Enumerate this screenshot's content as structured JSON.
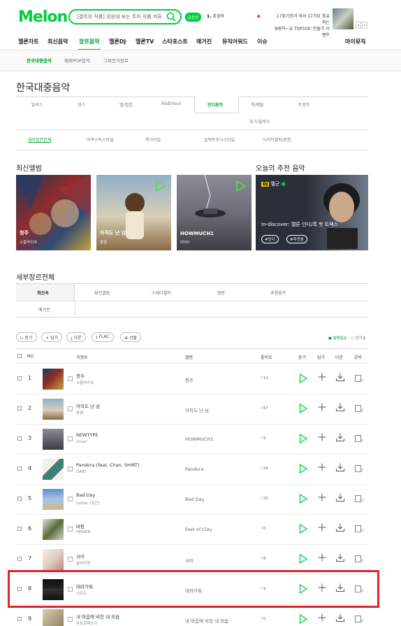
{
  "header": {
    "logo": "Melon",
    "search_text": "[결주의 작품] 망원에 보는 주차 작품 피류",
    "keyword_badge": "급상승",
    "keyword_rank": "1.",
    "keyword_text": "흑섬바",
    "banner_text_1": "17위기진과 와서 17가요 혹유외는",
    "banner_text_2": "'8원하~유 TOP100' 만들기 이벤트",
    "banner_prev": "‹",
    "banner_next": "›"
  },
  "main_nav": {
    "items": [
      "멜론차트",
      "최신음악",
      "장르음악",
      "멜론DJ",
      "멜론TV",
      "스타포스트",
      "매거진",
      "뮤직어워드",
      "이슈"
    ],
    "right": "마이뮤직"
  },
  "sub_nav": {
    "items": [
      "한국대중음악",
      "해외POP음악",
      "그외인기장르"
    ]
  },
  "page_title": "한국대중음악",
  "genres": {
    "row1": [
      "발라드",
      "댄스",
      "랩/힙합",
      "R&B/Soul",
      "인디음악",
      "록/메탈",
      "트로트"
    ],
    "row2": [
      "포크/블루스"
    ],
    "detail": [
      "세부장르전체",
      "어쿠스틱스타일",
      "록스타일",
      "일렉트로닉스타일",
      "사이키델릭/원천"
    ]
  },
  "latest_albums": {
    "title": "최신앨범",
    "items": [
      {
        "name": "청주",
        "artist": "소울라이츠"
      },
      {
        "name": "아직도 난 넘",
        "artist": "윤형"
      },
      {
        "name": "HOWMUCH1",
        "artist": "DYDI"
      }
    ]
  },
  "recommend": {
    "title": "오늘의 추천 음악",
    "dj_badge": "DJ",
    "dj_name": "멜군",
    "text": "In-discover: 멜론 인디/록 핫 트랙스",
    "tags": [
      "#인디",
      "#추천음"
    ]
  },
  "subgenre": {
    "title": "세부장르전체",
    "tabs": [
      "최신곡",
      "최신앨범",
      "스테디셀러",
      "명반",
      "추천음악",
      "매거진"
    ]
  },
  "actions": {
    "buttons": [
      "듣기",
      "담기",
      "다운",
      "FLAC",
      "선물"
    ],
    "sort_on": "발매일순",
    "sort_off": "인기순"
  },
  "table": {
    "headers": [
      "NO",
      "곡정보",
      "앨범",
      "좋아요",
      "듣기",
      "담기",
      "다운",
      "뮤비"
    ],
    "rows": [
      {
        "rank": "1",
        "title": "청주",
        "artist": "소울라이츠",
        "album": "청주",
        "likes": "11"
      },
      {
        "rank": "2",
        "title": "아직도 난 넘",
        "artist": "윤형",
        "album": "아직도 난 넘",
        "likes": "67"
      },
      {
        "rank": "3",
        "title": "NEWTYPE",
        "artist": "cheer",
        "album": "HOWMUCH1",
        "likes": "5"
      },
      {
        "rank": "4",
        "title": "Pandora (feat. Chan, SHIRT)",
        "artist": "OART",
        "album": "Pandora",
        "likes": "24"
      },
      {
        "rank": "5",
        "title": "Bad Day",
        "artist": "LeGon (조곤)",
        "album": "Bad Day",
        "likes": "25"
      },
      {
        "rank": "6",
        "title": "바람",
        "artist": "HEEBIN",
        "album": "Feet of Clay",
        "likes": "0"
      },
      {
        "rank": "7",
        "title": "사이",
        "artist": "달라무켓",
        "album": "사이",
        "likes": "8"
      },
      {
        "rank": "8",
        "title": "데려가줘",
        "artist": "시온오",
        "album": "데려가줘",
        "likes": "2"
      },
      {
        "rank": "9",
        "title": "내 마음에 비친 내 모습",
        "artist": "유토로렉스가",
        "album": "내 마음에 비친 내 모습",
        "likes": "0"
      }
    ]
  },
  "colors": {
    "brand": "#00cd3c",
    "highlight": "#e0242c"
  }
}
